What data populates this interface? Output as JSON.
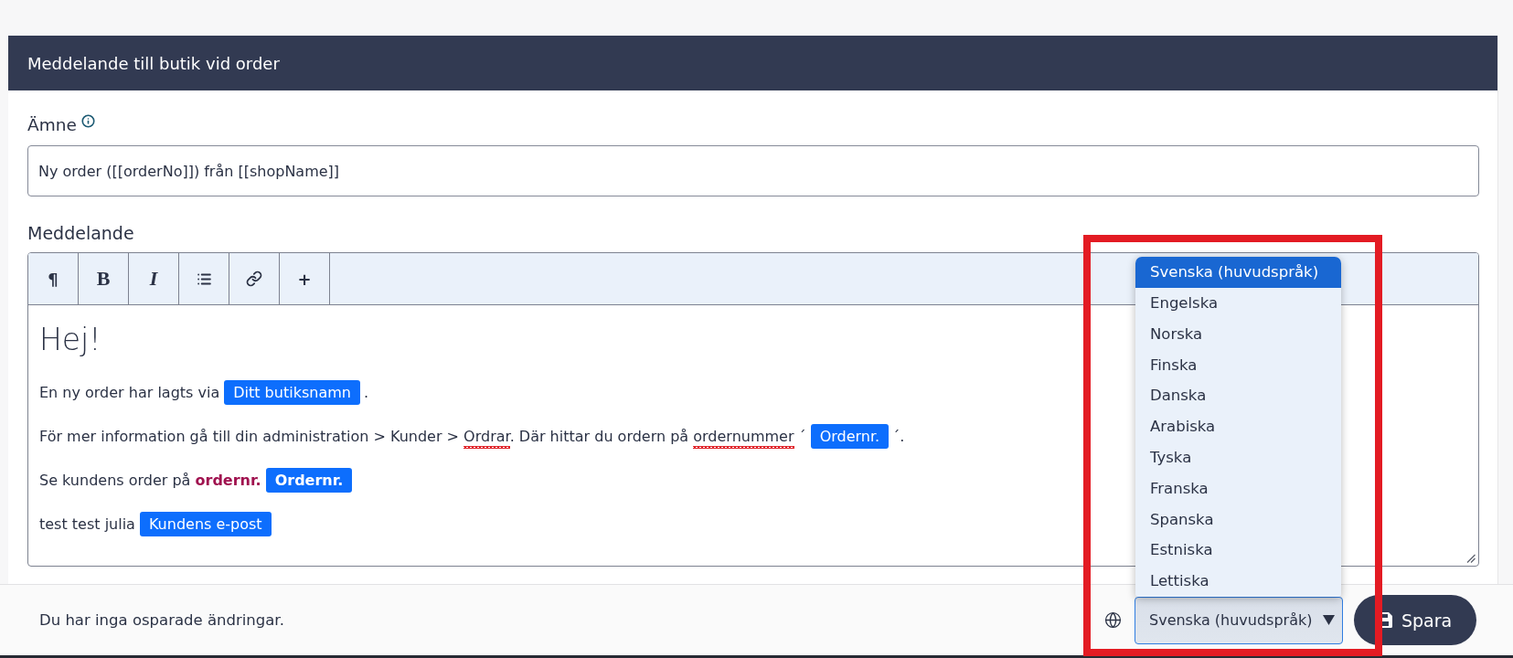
{
  "panel": {
    "title": "Meddelande till butik vid order"
  },
  "subject": {
    "label": "Ämne",
    "value": "Ny order ([[orderNo]]) från [[shopName]]"
  },
  "message": {
    "label": "Meddelande",
    "toolbar": [
      {
        "kind": "paragraph",
        "label": "¶"
      },
      {
        "kind": "bold",
        "label": "B"
      },
      {
        "kind": "italic",
        "label": "I"
      },
      {
        "kind": "list"
      },
      {
        "kind": "link"
      },
      {
        "kind": "insert",
        "label": "+"
      }
    ],
    "heading": "Hej!",
    "paragraphs": [
      {
        "parts": [
          {
            "kind": "text",
            "pieces": [
              {
                "text": "En ny order har lagts via",
                "misspelled": false
              }
            ]
          },
          {
            "kind": "tag",
            "text": "Ditt butiksnamn",
            "bold": false
          },
          {
            "kind": "text",
            "pieces": [
              {
                "text": ".",
                "misspelled": false
              }
            ]
          }
        ]
      },
      {
        "parts": [
          {
            "kind": "text",
            "pieces": [
              {
                "text": "För mer information gå till din administration > Kunder > ",
                "misspelled": false
              },
              {
                "text": "Ordrar",
                "misspelled": true
              },
              {
                "text": ". Där hittar du ordern på ",
                "misspelled": false
              },
              {
                "text": "ordernummer",
                "misspelled": true
              },
              {
                "text": " ´",
                "misspelled": false
              }
            ]
          },
          {
            "kind": "tag",
            "text": "Ordernr.",
            "bold": false
          },
          {
            "kind": "text",
            "pieces": [
              {
                "text": "´.",
                "misspelled": false
              }
            ]
          }
        ]
      },
      {
        "parts": [
          {
            "kind": "text",
            "pieces": [
              {
                "text": "Se kundens order på **ordernr.**",
                "misspelled": false
              }
            ]
          },
          {
            "kind": "tag",
            "text": "Ordernr.",
            "bold": true
          }
        ]
      },
      {
        "parts": [
          {
            "kind": "text",
            "pieces": [
              {
                "text": "test test julia",
                "misspelled": false
              }
            ]
          },
          {
            "kind": "tag",
            "text": "Kundens e-post",
            "bold": false
          }
        ]
      }
    ]
  },
  "footer": {
    "status": "Du har inga osparade ändringar.",
    "language_select": {
      "value": "Svenska (huvudspråk)",
      "expanded": true,
      "options": [
        {
          "label": "Svenska (huvudspråk)",
          "selected": true
        },
        {
          "label": "Engelska",
          "selected": false
        },
        {
          "label": "Norska",
          "selected": false
        },
        {
          "label": "Finska",
          "selected": false
        },
        {
          "label": "Danska",
          "selected": false
        },
        {
          "label": "Arabiska",
          "selected": false
        },
        {
          "label": "Tyska",
          "selected": false
        },
        {
          "label": "Franska",
          "selected": false
        },
        {
          "label": "Spanska",
          "selected": false
        },
        {
          "label": "Estniska",
          "selected": false
        },
        {
          "label": "Lettiska",
          "selected": false
        }
      ]
    },
    "save_button": {
      "label": "Spara"
    }
  },
  "annotations": [
    {
      "kind": "rectangle"
    }
  ]
}
